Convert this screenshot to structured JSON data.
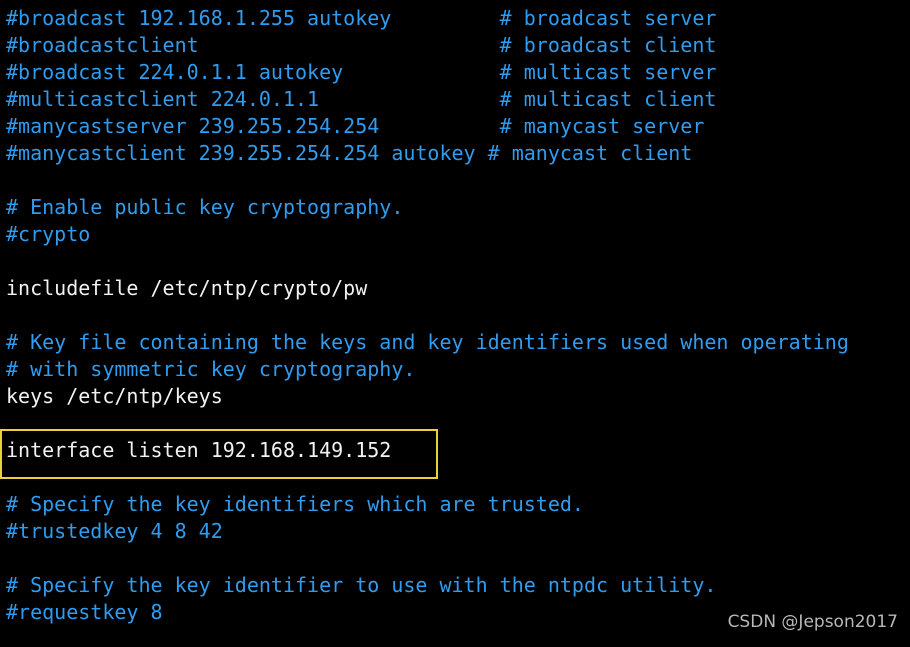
{
  "terminal": {
    "lines": [
      {
        "text": "#broadcast 192.168.1.255 autokey         # broadcast server",
        "kind": "comment"
      },
      {
        "text": "#broadcastclient                         # broadcast client",
        "kind": "comment"
      },
      {
        "text": "#broadcast 224.0.1.1 autokey             # multicast server",
        "kind": "comment"
      },
      {
        "text": "#multicastclient 224.0.1.1               # multicast client",
        "kind": "comment"
      },
      {
        "text": "#manycastserver 239.255.254.254          # manycast server",
        "kind": "comment"
      },
      {
        "text": "#manycastclient 239.255.254.254 autokey # manycast client",
        "kind": "comment"
      },
      {
        "text": "",
        "kind": "blank"
      },
      {
        "text": "# Enable public key cryptography.",
        "kind": "comment"
      },
      {
        "text": "#crypto",
        "kind": "comment"
      },
      {
        "text": "",
        "kind": "blank"
      },
      {
        "text": "includefile /etc/ntp/crypto/pw",
        "kind": "text"
      },
      {
        "text": "",
        "kind": "blank"
      },
      {
        "text": "# Key file containing the keys and key identifiers used when operating",
        "kind": "comment"
      },
      {
        "text": "# with symmetric key cryptography.",
        "kind": "comment"
      },
      {
        "text": "keys /etc/ntp/keys",
        "kind": "text"
      },
      {
        "text": "",
        "kind": "blank"
      },
      {
        "text": "interface listen 192.168.149.152",
        "kind": "text",
        "highlighted": true
      },
      {
        "text": "",
        "kind": "blank"
      },
      {
        "text": "# Specify the key identifiers which are trusted.",
        "kind": "comment"
      },
      {
        "text": "#trustedkey 4 8 42",
        "kind": "comment"
      },
      {
        "text": "",
        "kind": "blank"
      },
      {
        "text": "# Specify the key identifier to use with the ntpdc utility.",
        "kind": "comment"
      },
      {
        "text": "#requestkey 8",
        "kind": "comment"
      }
    ]
  },
  "watermark": "CSDN @Jepson2017",
  "colors": {
    "comment": "#2f9cf0",
    "text": "#f2f2f2",
    "highlight_border": "#ecd03a",
    "background": "#000000"
  }
}
